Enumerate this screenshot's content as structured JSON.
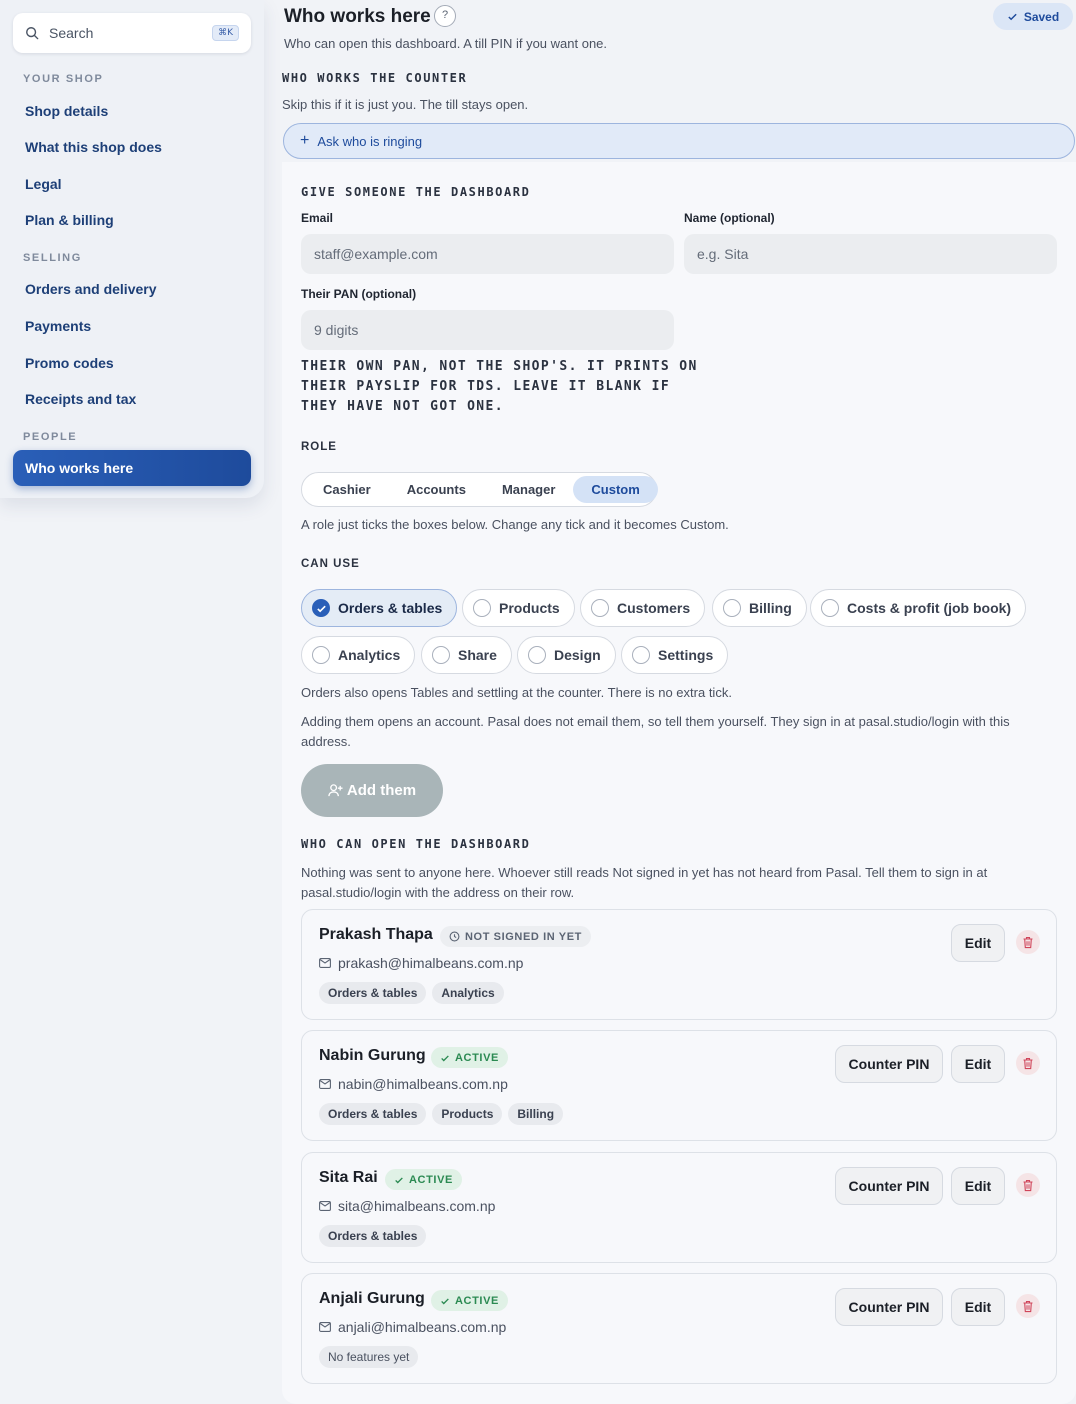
{
  "sidebar": {
    "search": {
      "label": "Search",
      "shortcut": "⌘K"
    },
    "sections": [
      {
        "title": "YOUR SHOP",
        "items": [
          "Shop details",
          "What this shop does",
          "Legal",
          "Plan & billing"
        ]
      },
      {
        "title": "SELLING",
        "items": [
          "Orders and delivery",
          "Payments",
          "Promo codes",
          "Receipts and tax"
        ]
      },
      {
        "title": "PEOPLE",
        "items": [
          "Who works here"
        ]
      }
    ],
    "active_item": "Who works here"
  },
  "header": {
    "title": "Who works here",
    "help": "?",
    "subtitle": "Who can open this dashboard. A till PIN if you want one.",
    "saved": "Saved"
  },
  "counter": {
    "label": "WHO WORKS THE COUNTER",
    "text": "Skip this if it is just you. The till stays open.",
    "ask_button": "Ask who is ringing"
  },
  "invite": {
    "label": "GIVE SOMEONE THE DASHBOARD",
    "email_label": "Email",
    "email_placeholder": "staff@example.com",
    "name_label": "Name (optional)",
    "name_placeholder": "e.g. Sita",
    "pan_label": "Their PAN (optional)",
    "pan_placeholder": "9 digits",
    "pan_note": "THEIR OWN PAN, NOT THE SHOP'S. IT PRINTS ON THEIR PAYSLIP FOR TDS. LEAVE IT BLANK IF THEY HAVE NOT GOT ONE.",
    "role_label": "ROLE",
    "roles": [
      "Cashier",
      "Accounts",
      "Manager",
      "Custom"
    ],
    "active_role": "Custom",
    "role_note": "A role just ticks the boxes below. Change any tick and it becomes Custom.",
    "can_use_label": "CAN USE",
    "features": [
      {
        "label": "Orders & tables",
        "checked": true
      },
      {
        "label": "Products",
        "checked": false
      },
      {
        "label": "Customers",
        "checked": false
      },
      {
        "label": "Billing",
        "checked": false
      },
      {
        "label": "Costs & profit (job book)",
        "checked": false
      },
      {
        "label": "Analytics",
        "checked": false
      },
      {
        "label": "Share",
        "checked": false
      },
      {
        "label": "Design",
        "checked": false
      },
      {
        "label": "Settings",
        "checked": false
      }
    ],
    "orders_note": "Orders also opens Tables and settling at the counter. There is no extra tick.",
    "account_note": "Adding them opens an account. Pasal does not email them, so tell them yourself. They sign in at pasal.studio/login with this address.",
    "add_button": "Add them"
  },
  "team": {
    "label": "WHO CAN OPEN THE DASHBOARD",
    "note": "Nothing was sent to anyone here. Whoever still reads Not signed in yet has not heard from Pasal. Tell them to sign in at pasal.studio/login with the address on their row.",
    "members": [
      {
        "name": "Prakash Thapa",
        "status": "NOT SIGNED IN YET",
        "email": "prakash@himalbeans.com.np",
        "tags": [
          "Orders & tables",
          "Analytics"
        ],
        "pin_button": "",
        "edit": "Edit"
      },
      {
        "name": "Nabin Gurung",
        "status": "ACTIVE",
        "email": "nabin@himalbeans.com.np",
        "tags": [
          "Orders & tables",
          "Products",
          "Billing"
        ],
        "pin_button": "Counter PIN",
        "edit": "Edit"
      },
      {
        "name": "Sita Rai",
        "status": "ACTIVE",
        "email": "sita@himalbeans.com.np",
        "tags": [
          "Orders & tables"
        ],
        "pin_button": "Counter PIN",
        "edit": "Edit"
      },
      {
        "name": "Anjali Gurung",
        "status": "ACTIVE",
        "email": "anjali@himalbeans.com.np",
        "tags": [
          "No features yet"
        ],
        "pin_button": "Counter PIN",
        "edit": "Edit"
      }
    ]
  },
  "colors": {
    "accent": "#2a5fb8",
    "active_green": "#2b8a52",
    "danger": "#d0455a"
  }
}
